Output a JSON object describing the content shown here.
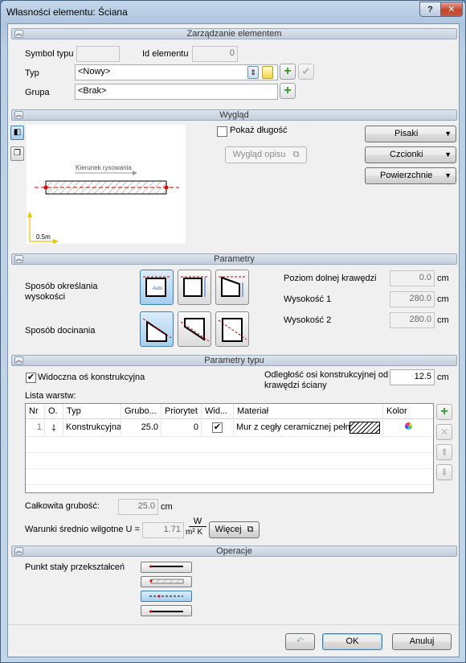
{
  "window": {
    "title": "Własności elementu: Ściana"
  },
  "sections": {
    "management": "Zarządzanie elementem",
    "appearance": "Wygląd",
    "parameters": "Parametry",
    "type_parameters": "Parametry typu",
    "operations": "Operacje"
  },
  "management": {
    "symbol_label": "Symbol typu",
    "symbol_value": "",
    "id_label": "Id elementu",
    "id_value": "0",
    "type_label": "Typ",
    "type_value": "<Nowy>",
    "group_label": "Grupa",
    "group_value": "<Brak>"
  },
  "appearance": {
    "show_length_label": "Pokaż długość",
    "show_length_checked": false,
    "description_button": "Wygląd opisu",
    "preview_direction": "Kierunek rysowania",
    "preview_scale": "0.5m",
    "pens_button": "Pisaki",
    "fonts_button": "Czcionki",
    "surfaces_button": "Powierzchnie"
  },
  "parameters": {
    "height_mode_label": "Sposób określania wysokości",
    "trim_mode_label": "Sposób docinania",
    "auto_label": "Auto",
    "bottom_level_label": "Poziom dolnej krawędzi",
    "bottom_level_value": "0.0",
    "height1_label": "Wysokość 1",
    "height1_value": "280.0",
    "height2_label": "Wysokość 2",
    "height2_value": "280.0",
    "unit": "cm"
  },
  "type_params": {
    "axis_visible_label": "Widoczna oś konstrukcyjna",
    "axis_visible_checked": true,
    "axis_offset_label_1": "Odległość osi konstrukcyjnej od",
    "axis_offset_label_2": "krawędzi ściany",
    "axis_offset_value": "12.5",
    "unit": "cm",
    "layers_label": "Lista warstw:",
    "columns": [
      "Nr",
      "O.",
      "Typ",
      "Grubo...",
      "Priorytet",
      "Wid...",
      "Materiał",
      "Kolor"
    ],
    "rows": [
      {
        "nr": "1",
        "type": "Konstrukcyjna",
        "thickness": "25.0",
        "priority": "0",
        "visible": true,
        "material": "Mur z cegły ceramicznej pełn"
      }
    ],
    "total_label": "Całkowita grubość:",
    "total_value": "25.0",
    "total_unit": "cm",
    "humidity_label": "Warunki średnio wilgotne U =",
    "humidity_value": "1.71",
    "humidity_unit_num": "W",
    "humidity_unit_den": "m² K",
    "more_button": "Więcej"
  },
  "operations": {
    "fixed_point_label": "Punkt stały przekształceń"
  },
  "footer": {
    "ok_button": "OK",
    "cancel_button": "Anuluj"
  }
}
